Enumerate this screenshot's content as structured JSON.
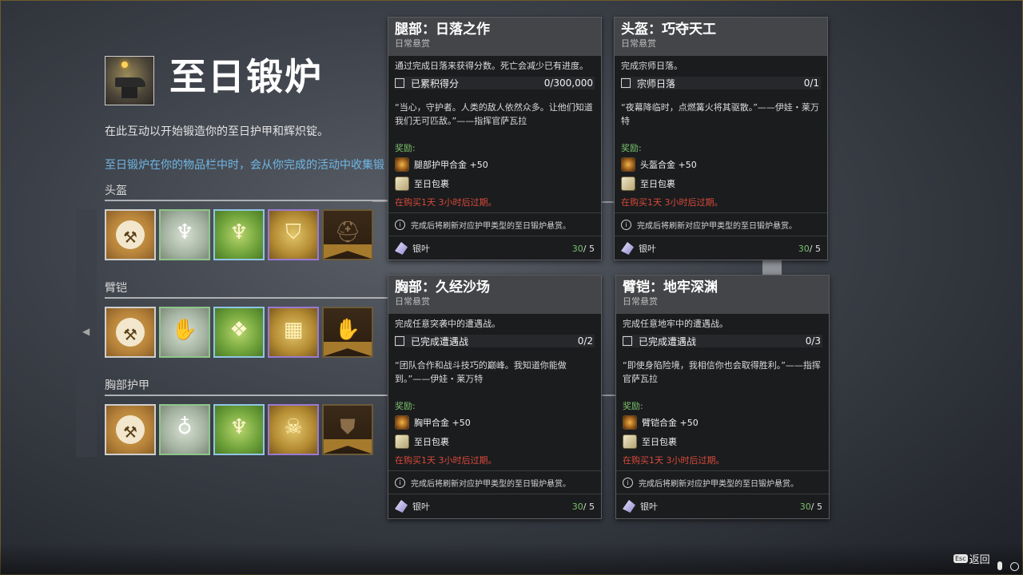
{
  "header": {
    "title": "至日锻炉",
    "description": "在此互动以开始锻造你的至日护甲和辉炽锭。",
    "hint": "至日锻炉在你的物品栏中时，会从你完成的活动中收集锻"
  },
  "categories": [
    {
      "label": "头盔",
      "icons": [
        "anvil-icon",
        "helmet-flame-silver-icon",
        "helmet-flame-green-icon",
        "helmet-flame-gold-icon",
        "helmet-banner-icon"
      ]
    },
    {
      "label": "臂铠",
      "icons": [
        "anvil-icon",
        "gauntlet-flame-silver-icon",
        "gauntlet-flame-green-icon",
        "gauntlet-flame-gold-icon",
        "gauntlet-banner-icon"
      ]
    },
    {
      "label": "胸部护甲",
      "icons": [
        "anvil-icon",
        "chest-flame-silver-icon",
        "chest-flame-green-icon",
        "chest-skull-gold-icon",
        "chest-banner-icon"
      ]
    }
  ],
  "bounties": [
    {
      "title": "腿部：日落之作",
      "type": "日常悬赏",
      "objective_desc": "通过完成日落来获得分数。死亡会减少已有进度。",
      "objective_label": "已累积得分",
      "objective_value": "0/300,000",
      "lore": "“当心，守护者。人类的敌人依然众多。让他们知道我们无可匹敌。”——指挥官萨瓦拉",
      "reward_header": "奖励:",
      "reward1": "腿部护甲合金 +50",
      "reward2": "至日包裹",
      "expire": "在购买1天 3小时后过期。",
      "note": "完成后将刷新对应护甲类型的至日锻炉悬赏。",
      "currency": "银叶",
      "count": "30",
      "max": " / 5"
    },
    {
      "title": "头盔：巧夺天工",
      "type": "日常悬赏",
      "objective_desc": "完成宗师日落。",
      "objective_label": "宗师日落",
      "objective_value": "0/1",
      "lore": "“夜幕降临时，点燃篝火将其驱散。”——伊娃・莱万特",
      "reward_header": "奖励:",
      "reward1": "头盔合金 +50",
      "reward2": "至日包裹",
      "expire": "在购买1天 3小时后过期。",
      "note": "完成后将刷新对应护甲类型的至日锻炉悬赏。",
      "currency": "银叶",
      "count": "30",
      "max": " / 5"
    },
    {
      "title": "胸部：久经沙场",
      "type": "日常悬赏",
      "objective_desc": "完成任意突袭中的遭遇战。",
      "objective_label": "已完成遭遇战",
      "objective_value": "0/2",
      "lore": "“团队合作和战斗技巧的巅峰。我知道你能做到。”——伊娃・莱万特",
      "reward_header": "奖励:",
      "reward1": "胸甲合金 +50",
      "reward2": "至日包裹",
      "expire": "在购买1天 3小时后过期。",
      "note": "完成后将刷新对应护甲类型的至日锻炉悬赏。",
      "currency": "银叶",
      "count": "30",
      "max": " / 5"
    },
    {
      "title": "臂铠：地牢深渊",
      "type": "日常悬赏",
      "objective_desc": "完成任意地牢中的遭遇战。",
      "objective_label": "已完成遭遇战",
      "objective_value": "0/3",
      "lore": "“即使身陷险境，我相信你也会取得胜利。”——指挥官萨瓦拉",
      "reward_header": "奖励:",
      "reward1": "臂铠合金 +50",
      "reward2": "至日包裹",
      "expire": "在购买1天 3小时后过期。",
      "note": "完成后将刷新对应护甲类型的至日锻炉悬赏。",
      "currency": "银叶",
      "count": "30",
      "max": " / 5"
    }
  ],
  "footer": {
    "esc_key": "Esc",
    "back_label": "返回"
  }
}
